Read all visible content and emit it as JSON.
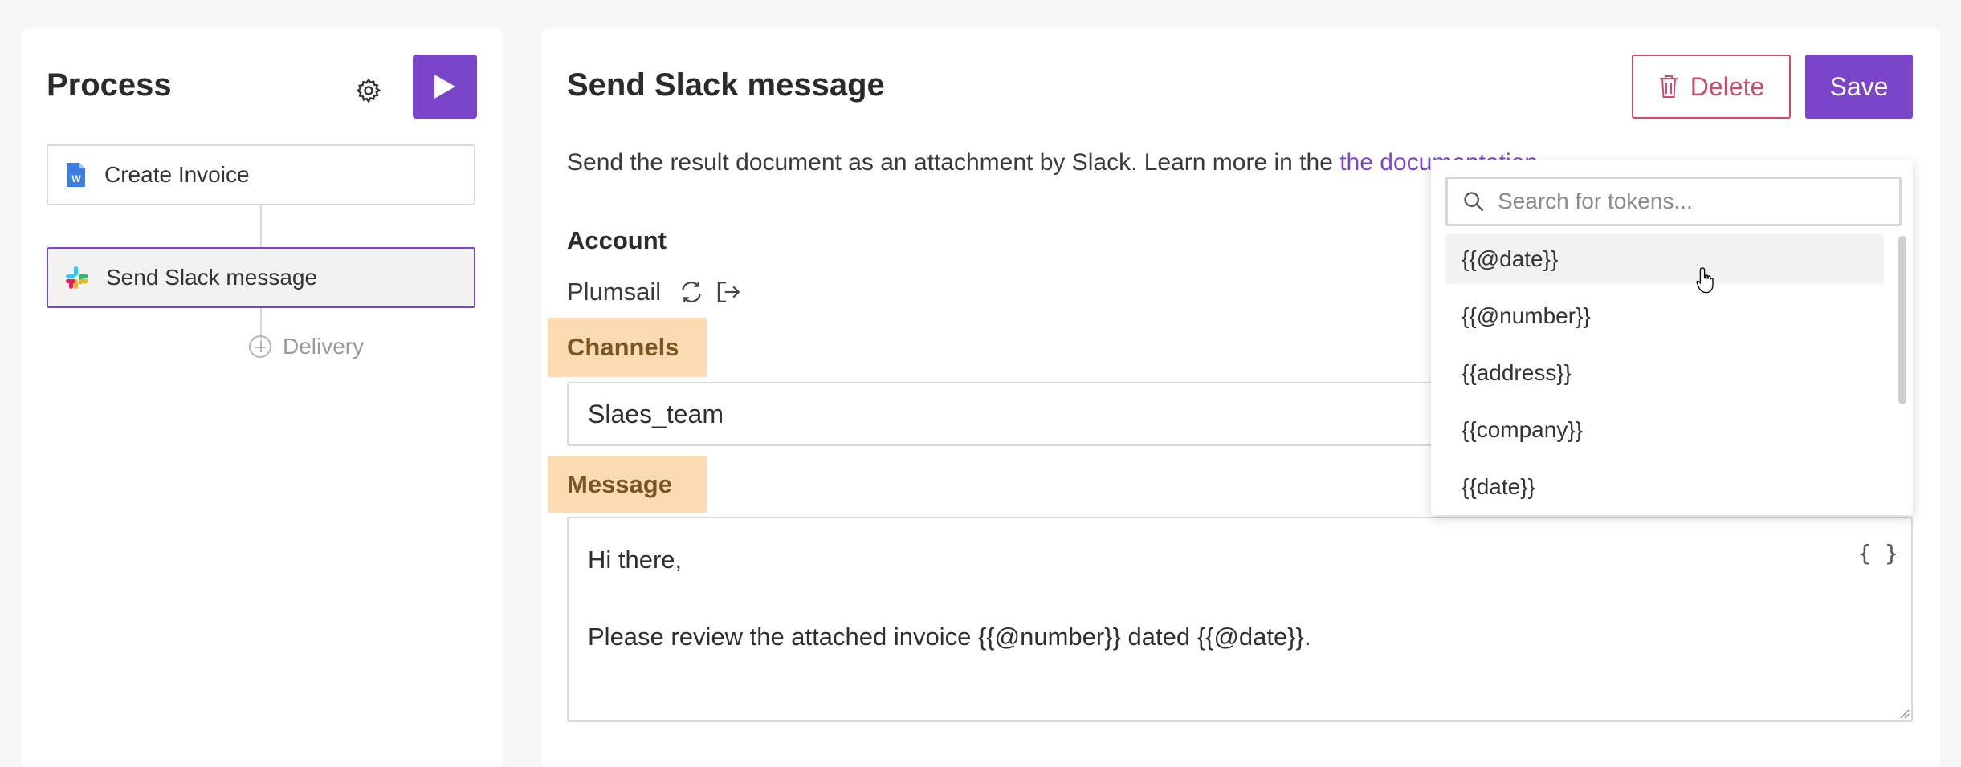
{
  "left_panel": {
    "title": "Process",
    "steps": [
      {
        "label": "Create Invoice",
        "icon": "word-document-icon"
      },
      {
        "label": "Send Slack message",
        "icon": "slack-icon"
      }
    ],
    "add_label": "Delivery"
  },
  "right_panel": {
    "title": "Send Slack message",
    "delete_label": "Delete",
    "save_label": "Save",
    "description": "Send the result document as an attachment by Slack. Learn more in the ",
    "link_text": "the documentation",
    "account_label": "Account",
    "account_value": "Plumsail",
    "channels_label": "Channels",
    "channels_value": "Slaes_team",
    "message_label": "Message",
    "message_line1": "Hi there,",
    "message_line2": "Please review the attached invoice {{@number}} dated {{@date}}.",
    "token_button": "{ }"
  },
  "token_dropdown": {
    "search_placeholder": "Search for tokens...",
    "items": [
      "{{@date}}",
      "{{@number}}",
      "{{address}}",
      "{{company}}",
      "{{date}}"
    ]
  },
  "colors": {
    "accent": "#7b45c9",
    "danger": "#d04a6a",
    "highlight": "#fadbb2"
  }
}
